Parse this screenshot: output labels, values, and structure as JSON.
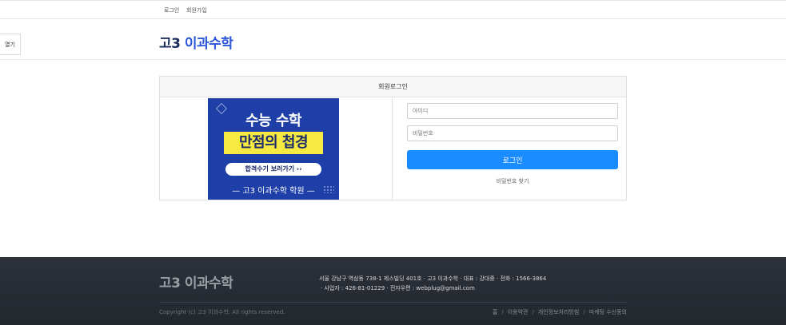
{
  "topbar": {
    "login_label": "로그인",
    "signup_label": "회원가입"
  },
  "header": {
    "logo_num": "고3",
    "logo_text": "이과수학"
  },
  "side_toggle": {
    "label": "열기"
  },
  "login": {
    "title": "회원로그인",
    "id_placeholder": "아이디",
    "pw_placeholder": "비밀번호",
    "submit_label": "로그인",
    "find_label": "비밀번호 찾기"
  },
  "banner": {
    "line1": "수능 수학",
    "line2": "만점의 첩경",
    "cta": "합격수기 보러가기 ››",
    "footer": "— 고3 이과수학 학원 —",
    "colors": {
      "bg": "#1e3fa8",
      "highlight": "#f6ea42"
    }
  },
  "footer": {
    "logo": "고3 이과수학",
    "address_line1": "서울 강남구 역삼동 738-1 제스빌딩 401호  · 고3 이과수학  · 대표 : 강대중  · 전화 : 1566-3864",
    "address_line2": "· 사업자 : 426-81-01229  · 전자우편 : webplug@gmail.com",
    "copyright": "Copyright (c) 고3 이과수학. All rights reserved.",
    "links": [
      "홈",
      "이용약관",
      "개인정보처리방침",
      "마케팅 수신동의"
    ]
  },
  "colors": {
    "accent": "#1a8cff",
    "brand": "#1b2c5e",
    "footer_bg": "#2c313a"
  }
}
